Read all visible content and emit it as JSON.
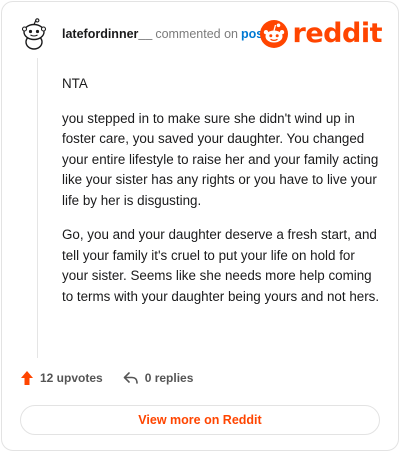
{
  "header": {
    "username": "latefordinner__",
    "commented_text": "commented on",
    "post_link": "post",
    "brand": "reddit"
  },
  "comment": {
    "paragraphs": [
      "NTA",
      "you stepped in to make sure she didn't wind up in foster care, you saved your daughter. You changed your entire lifestyle to raise her and your family acting like your sister has any rights or you have to live your life by her is disgusting.",
      "Go, you and your daughter deserve a fresh start, and tell your family it's cruel to put your life on hold for your sister. Seems like she needs more help coming to terms with your daughter being yours and not hers."
    ]
  },
  "actions": {
    "upvotes": "12 upvotes",
    "replies": "0 replies"
  },
  "footer": {
    "view_more": "View more on Reddit"
  },
  "colors": {
    "brand": "#ff4500",
    "link": "#0079d3"
  },
  "icons": {
    "avatar": "snoo-avatar-icon",
    "brand": "reddit-logo-icon",
    "upvote": "upvote-arrow-icon",
    "reply": "reply-arrow-icon"
  }
}
